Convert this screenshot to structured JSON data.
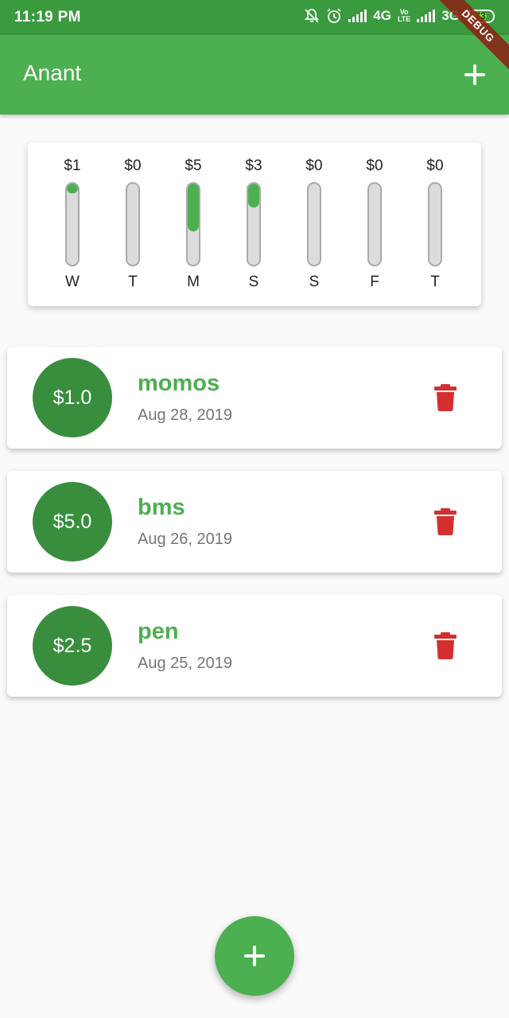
{
  "status_bar": {
    "time": "11:19 PM",
    "network_1": "4G",
    "network_2": "3G",
    "volte_top": "Vo",
    "volte_bottom": "LTE",
    "battery": "73",
    "battery_level": 0.73,
    "battery_color": "#7cd62f",
    "icons": [
      "notifications-off-icon",
      "alarm-icon",
      "signal-icon",
      "volte-icon",
      "signal-icon",
      "battery-icon"
    ]
  },
  "debug_banner": "DEBUG",
  "app_bar": {
    "title": "Anant",
    "action_icon": "add-icon",
    "color": "#4caf50"
  },
  "chart": {
    "bars": [
      {
        "day": "W",
        "amount": "$1",
        "fraction": 0.12
      },
      {
        "day": "T",
        "amount": "$0",
        "fraction": 0
      },
      {
        "day": "M",
        "amount": "$5",
        "fraction": 0.59
      },
      {
        "day": "S",
        "amount": "$3",
        "fraction": 0.29
      },
      {
        "day": "S",
        "amount": "$0",
        "fraction": 0
      },
      {
        "day": "F",
        "amount": "$0",
        "fraction": 0
      },
      {
        "day": "T",
        "amount": "$0",
        "fraction": 0
      }
    ],
    "fill_color": "#4caf50"
  },
  "transactions": [
    {
      "amount": "$1.0",
      "title": "momos",
      "date": "Aug 28, 2019"
    },
    {
      "amount": "$5.0",
      "title": "bms",
      "date": "Aug 26, 2019"
    },
    {
      "amount": "$2.5",
      "title": "pen",
      "date": "Aug 25, 2019"
    }
  ],
  "delete_icon": "delete-icon",
  "delete_color": "#d32f2f",
  "fab": {
    "icon": "add-icon"
  }
}
